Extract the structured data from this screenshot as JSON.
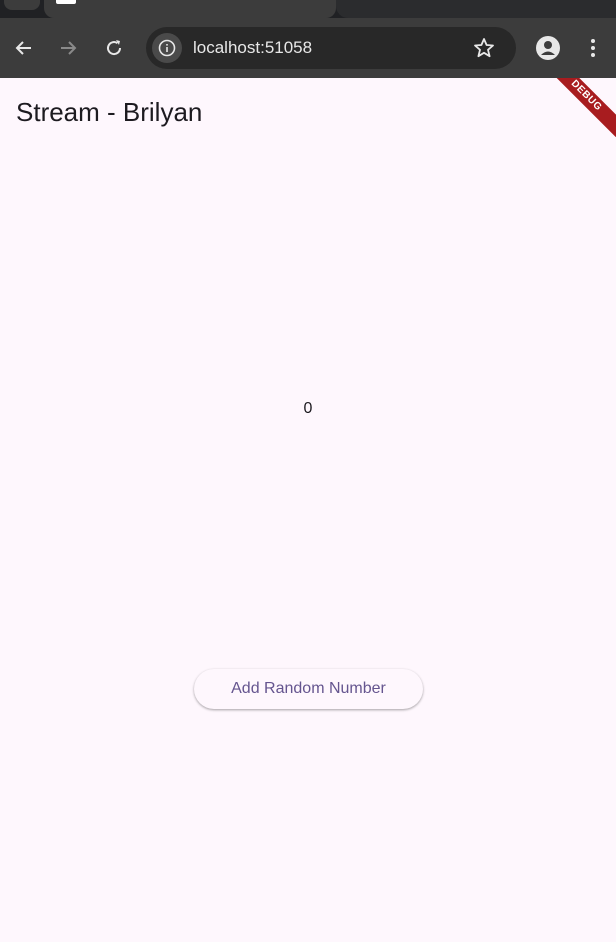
{
  "browser": {
    "url": "localhost:51058",
    "icons": {
      "back": "arrow-left-icon",
      "forward": "arrow-right-icon",
      "reload": "reload-icon",
      "site_info": "info-icon",
      "bookmark": "star-icon",
      "profile": "person-icon",
      "menu": "vertical-dots-icon"
    }
  },
  "app": {
    "title": "Stream - Brilyan",
    "debug_banner": "DEBUG",
    "value": "0",
    "add_button_label": "Add Random Number"
  },
  "colors": {
    "background": "#fef7fd",
    "accent": "#65558f",
    "debug": "#a81c1f"
  }
}
